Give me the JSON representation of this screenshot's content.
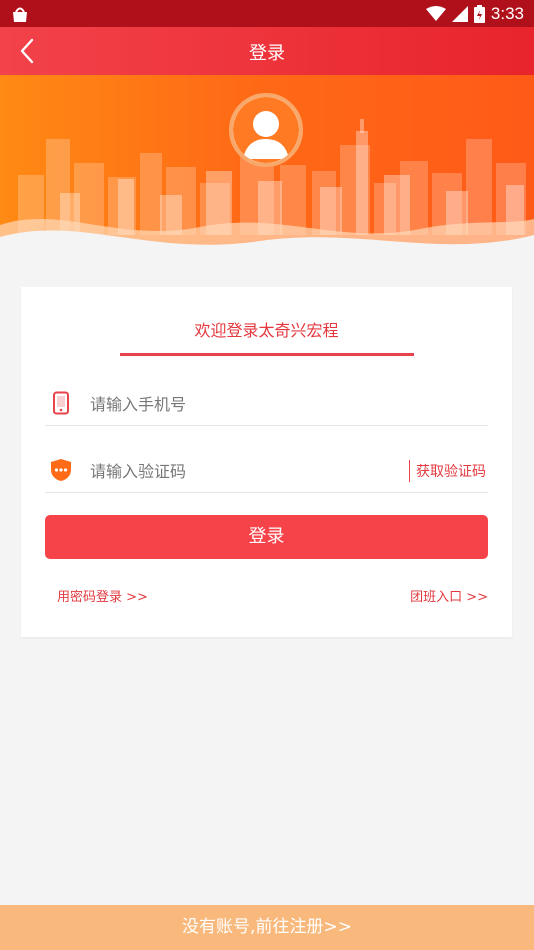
{
  "status_bar": {
    "time": "3:33"
  },
  "header": {
    "title": "登录"
  },
  "card": {
    "welcome": "欢迎登录太奇兴宏程",
    "phone_placeholder": "请输入手机号",
    "code_placeholder": "请输入验证码",
    "get_code_label": "获取验证码",
    "login_label": "登录",
    "password_login_link": "用密码登录 >>",
    "group_entry_link": "团班入口 >>"
  },
  "footer": {
    "register_label": "没有账号,前往注册>>"
  },
  "colors": {
    "primary_red": "#f6434a",
    "banner_orange": "#ff6a16",
    "register_bar": "#f9b97d"
  },
  "icons": [
    "back-arrow-icon",
    "avatar-icon",
    "phone-icon",
    "verify-code-icon",
    "wifi-icon",
    "signal-icon",
    "battery-icon"
  ]
}
